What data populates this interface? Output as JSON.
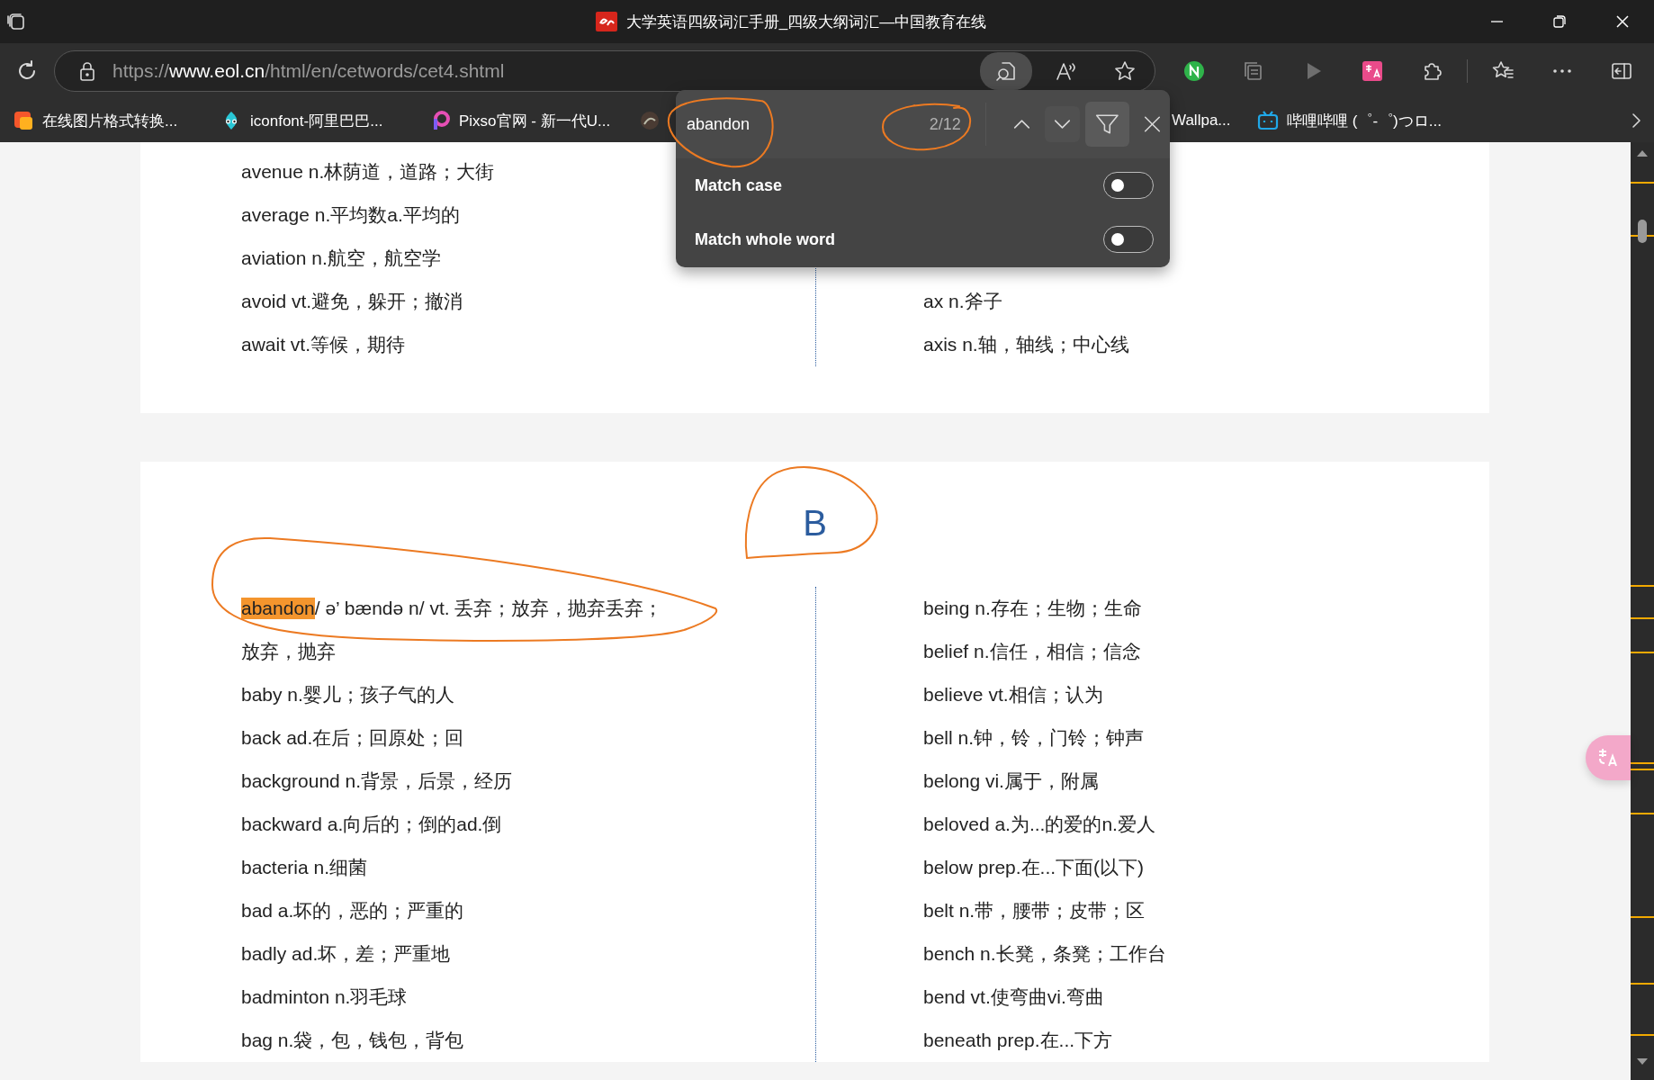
{
  "window": {
    "title": "大学英语四级词汇手册_四级大纲词汇—中国教育在线"
  },
  "address_bar": {
    "url_scheme": "https://",
    "url_host": "www.eol.cn",
    "url_path": "/html/en/cetwords/cet4.shtml"
  },
  "address_buttons": [
    {
      "kind": "find",
      "active": true
    },
    {
      "kind": "read-aloud",
      "active": false
    },
    {
      "kind": "favorite",
      "active": false
    }
  ],
  "toolbar_buttons": [
    {
      "kind": "n-extension"
    },
    {
      "kind": "collections"
    },
    {
      "kind": "play"
    },
    {
      "kind": "translate"
    },
    {
      "kind": "extensions"
    },
    {
      "kind": "separator"
    },
    {
      "kind": "favorites"
    },
    {
      "kind": "more"
    },
    {
      "kind": "sidebar"
    }
  ],
  "bookmarks": [
    {
      "kind": "converter",
      "label": "在线图片格式转换..."
    },
    {
      "kind": "iconfont",
      "label": "iconfont-阿里巴巴..."
    },
    {
      "kind": "pixso",
      "label": "Pixso官网 - 新一代U..."
    },
    {
      "kind": "round"
    },
    {
      "kind": "plain",
      "label": "Wallpa..."
    },
    {
      "kind": "bilibili",
      "label": "哔哩哔哩 (゜-゜)つロ..."
    }
  ],
  "find_bar": {
    "query": "abandon",
    "count": "2/12",
    "filter_active": true,
    "options": [
      {
        "label": "Match case",
        "on": false
      },
      {
        "label": "Match whole word",
        "on": false
      }
    ]
  },
  "sections": [
    {
      "left": [
        {
          "text": "avenue n.林荫道，道路；大街"
        },
        {
          "text": "average n.平均数a.平均的"
        },
        {
          "text": "aviation n.航空，航空学"
        },
        {
          "text": "avoid vt.避免，躲开；撤消"
        },
        {
          "text": "await vt.等候，期待"
        }
      ],
      "right": [
        {
          "text": "ax n.斧子"
        },
        {
          "text": "axis n.轴，轴线；中心线"
        }
      ]
    },
    {
      "heading": "B",
      "left": [
        {
          "match": "abandon",
          "current": true,
          "text": "/ ə’ bændə n/ vt. 丢弃；放弃，抛弃丢弃；"
        },
        {
          "text": "放弃，抛弃"
        },
        {
          "text": "baby n.婴儿；孩子气的人"
        },
        {
          "text": "back ad.在后；回原处；回"
        },
        {
          "text": "background n.背景，后景，经历"
        },
        {
          "text": "backward a.向后的；倒的ad.倒"
        },
        {
          "text": "bacteria n.细菌"
        },
        {
          "text": "bad a.坏的，恶的；严重的"
        },
        {
          "text": "badly ad.坏，差；严重地"
        },
        {
          "text": "badminton n.羽毛球"
        },
        {
          "text": "bag n.袋，包，钱包，背包"
        }
      ],
      "right": [
        {
          "text": "being n.存在；生物；生命"
        },
        {
          "text": "belief n.信任，相信；信念"
        },
        {
          "text": "believe vt.相信；认为"
        },
        {
          "text": "bell n.钟，铃，门铃；钟声"
        },
        {
          "text": "belong vi.属于，附属"
        },
        {
          "text": "beloved a.为...的爱的n.爱人"
        },
        {
          "text": "below prep.在...下面(以下)"
        },
        {
          "text": "belt n.带，腰带；皮带；区"
        },
        {
          "text": "bench n.长凳，条凳；工作台"
        },
        {
          "text": "bend vt.使弯曲vi.弯曲"
        },
        {
          "text": "beneath prep.在...下方"
        }
      ]
    }
  ]
}
